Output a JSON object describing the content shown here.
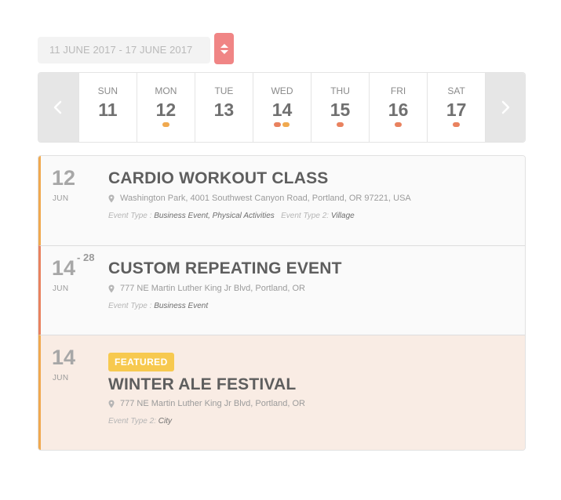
{
  "date_range": {
    "label": "11 JUNE 2017 - 17 JUNE 2017"
  },
  "colors": {
    "accent_red": "#f08585",
    "accent_orange": "#f0a94f",
    "featured_bg": "#f9ece4",
    "badge": "#f7c94f"
  },
  "week": {
    "prev_icon": "chevron-left-icon",
    "next_icon": "chevron-right-icon",
    "days": [
      {
        "name": "SUN",
        "num": "11",
        "dots": []
      },
      {
        "name": "MON",
        "num": "12",
        "dots": [
          "#f0a94f"
        ]
      },
      {
        "name": "TUE",
        "num": "13",
        "dots": []
      },
      {
        "name": "WED",
        "num": "14",
        "dots": [
          "#e9825f",
          "#f0a94f"
        ]
      },
      {
        "name": "THU",
        "num": "15",
        "dots": [
          "#e9825f"
        ]
      },
      {
        "name": "FRI",
        "num": "16",
        "dots": [
          "#e9825f"
        ]
      },
      {
        "name": "SAT",
        "num": "17",
        "dots": [
          "#e9825f"
        ]
      }
    ]
  },
  "events": [
    {
      "day": "12",
      "day_end": "",
      "month": "JUN",
      "title": "CARDIO WORKOUT CLASS",
      "location": "Washington Park, 4001 Southwest Canyon Road, Portland, OR 97221, USA",
      "type_label": "Event Type :",
      "type_value": "Business Event,  Physical Activities",
      "type2_label": "Event Type 2:",
      "type2_value": "Village"
    },
    {
      "day": "14",
      "day_end": "- 28",
      "month": "JUN",
      "title": "CUSTOM REPEATING EVENT",
      "location": "777 NE Martin Luther King Jr Blvd, Portland, OR",
      "type_label": "Event Type :",
      "type_value": "Business Event"
    },
    {
      "day": "14",
      "day_end": "",
      "month": "JUN",
      "badge": "FEATURED",
      "title": "WINTER ALE FESTIVAL",
      "location": "777 NE Martin Luther King Jr Blvd, Portland, OR",
      "type2_label": "Event Type 2:",
      "type2_value": "City"
    }
  ]
}
